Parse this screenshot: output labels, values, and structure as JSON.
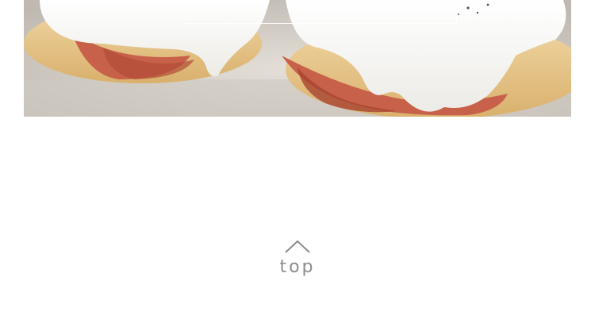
{
  "hero": {
    "image_icon": "eggs-benedict-photo",
    "banner_text": "",
    "colors": {
      "plate": "#d9d4cd",
      "muffin": "#e8c893",
      "ham": "#c8614a",
      "sauce": "#f7f6f2"
    }
  },
  "back_to_top": {
    "icon": "chevron-up-icon",
    "label": "top",
    "color": "#8c8c8c"
  }
}
